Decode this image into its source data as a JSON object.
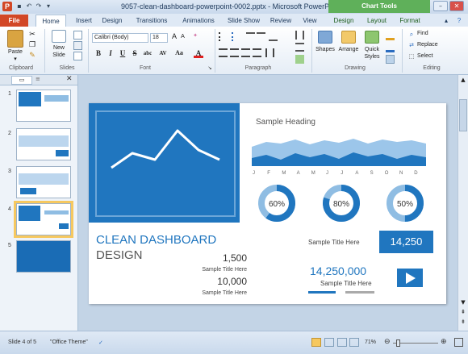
{
  "window": {
    "title": "9057-clean-dashboard-powerpoint-0002.pptx - Microsoft PowerPoint",
    "app_letter": "P",
    "chart_tools": "Chart Tools"
  },
  "tabs": [
    "File",
    "Home",
    "Insert",
    "Design",
    "Transitions",
    "Animations",
    "Slide Show",
    "Review",
    "View",
    "Design",
    "Layout",
    "Format"
  ],
  "ribbon": {
    "clipboard": {
      "label": "Clipboard",
      "paste": "Paste"
    },
    "slides": {
      "label": "Slides",
      "new_slide": "New Slide"
    },
    "font": {
      "label": "Font",
      "family": "Calibri (Body)",
      "size": "18",
      "bold": "B",
      "italic": "I",
      "underline": "U",
      "strike": "S",
      "shadow": "abc",
      "spacing": "AV",
      "case": "Aa",
      "color": "A"
    },
    "paragraph": {
      "label": "Paragraph"
    },
    "drawing": {
      "label": "Drawing",
      "shapes": "Shapes",
      "arrange": "Arrange",
      "quick_styles": "Quick Styles"
    },
    "editing": {
      "label": "Editing",
      "find": "Find",
      "replace": "Replace",
      "select": "Select"
    }
  },
  "panel": {
    "thumbs": [
      "1",
      "2",
      "3",
      "4",
      "5"
    ]
  },
  "slide": {
    "heading": "Sample Heading",
    "months": [
      "J",
      "F",
      "M",
      "A",
      "M",
      "J",
      "J",
      "A",
      "S",
      "O",
      "N",
      "D"
    ],
    "donuts": [
      {
        "label": "60%",
        "value": 0.6
      },
      {
        "label": "80%",
        "value": 0.8
      },
      {
        "label": "50%",
        "value": 0.5
      }
    ],
    "title1": "CLEAN DASHBOARD",
    "title2": "DESIGN",
    "stat1": "1,500",
    "stat1_label": "Sample Title Here",
    "stat2": "10,000",
    "stat2_label": "Sample Title Here",
    "box_label": "Sample Title Here",
    "box_value": "14,250",
    "big_value": "14,250,000",
    "big_label": "Sample Title Here",
    "colors": {
      "blue": "#2076bf",
      "light_blue": "#8fbde3"
    }
  },
  "status": {
    "slide": "Slide 4 of 5",
    "theme": "\"Office Theme\"",
    "zoom": "71%"
  }
}
